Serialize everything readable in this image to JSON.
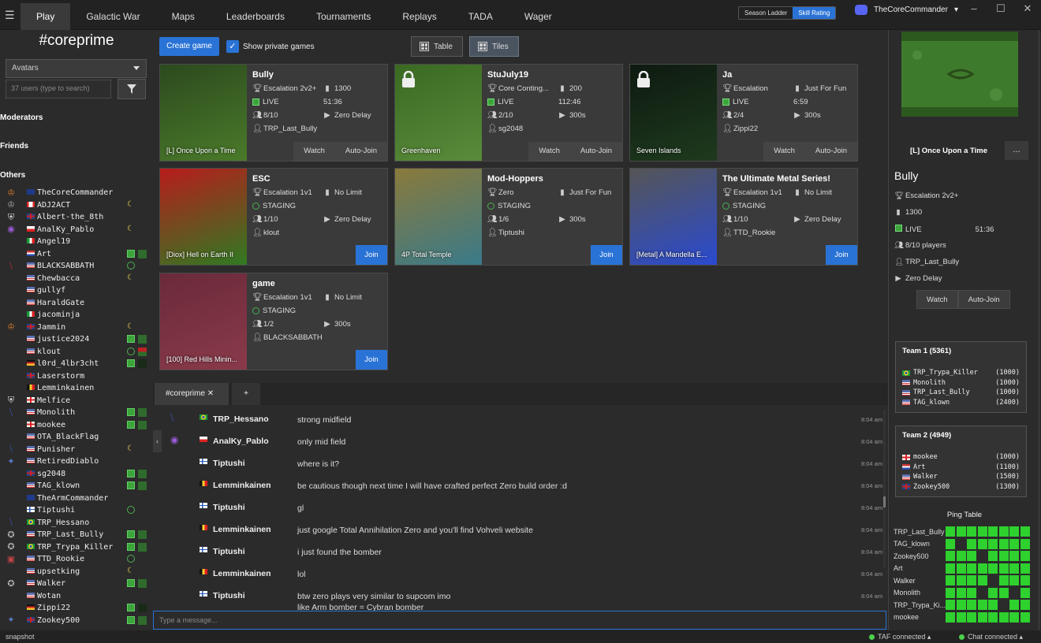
{
  "topbar": {
    "menu_icon": "hamburger-icon",
    "tabs": [
      "Play",
      "Galactic War",
      "Maps",
      "Leaderboards",
      "Tournaments",
      "Replays",
      "TADA",
      "Wager"
    ],
    "active_tab": "Play",
    "rating_toggle": [
      "Season Ladder",
      "Skill Rating"
    ],
    "rating_selected": "Skill Rating",
    "username": "TheCoreCommander",
    "window_controls": [
      "–",
      "☐",
      "✕"
    ]
  },
  "left": {
    "channel_title": "#coreprime",
    "avatar_select": "Avatars",
    "user_search_placeholder": "37 users (type to search)",
    "groups": [
      "Moderators",
      "Friends",
      "Others"
    ],
    "users": [
      {
        "name": "TheCoreCommander",
        "flag": "au",
        "avatar": "♔",
        "avcolor": "#e07a2a",
        "status": "",
        "map": ""
      },
      {
        "name": "ADJ2ACT",
        "flag": "ca",
        "avatar": "♔",
        "avcolor": "#aaa",
        "status": "moon",
        "map": ""
      },
      {
        "name": "Albert-the_8th",
        "flag": "gb",
        "avatar": "⛨",
        "avcolor": "#ddd",
        "status": "",
        "map": ""
      },
      {
        "name": "AnalKy_Pablo",
        "flag": "pl",
        "avatar": "◉",
        "avcolor": "#9a5ad6",
        "status": "moon",
        "map": ""
      },
      {
        "name": "Angel19",
        "flag": "it",
        "avatar": "",
        "avcolor": "",
        "status": "",
        "map": ""
      },
      {
        "name": "Art",
        "flag": "nl",
        "avatar": "",
        "avcolor": "",
        "status": "game",
        "map": "green"
      },
      {
        "name": "BLACKSABBATH",
        "flag": "us",
        "avatar": "⧹",
        "avcolor": "#c33",
        "status": "stg",
        "map": ""
      },
      {
        "name": "Chewbacca",
        "flag": "us",
        "avatar": "",
        "avcolor": "",
        "status": "moon",
        "map": ""
      },
      {
        "name": "gullyf",
        "flag": "us",
        "avatar": "",
        "avcolor": "",
        "status": "",
        "map": ""
      },
      {
        "name": "HaraldGate",
        "flag": "us",
        "avatar": "",
        "avcolor": "",
        "status": "",
        "map": ""
      },
      {
        "name": "jacominja",
        "flag": "it",
        "avatar": "",
        "avcolor": "",
        "status": "",
        "map": ""
      },
      {
        "name": "Jammin",
        "flag": "gb",
        "avatar": "♔",
        "avcolor": "#e07a2a",
        "status": "moon",
        "map": ""
      },
      {
        "name": "justice2024",
        "flag": "us",
        "avatar": "",
        "avcolor": "",
        "status": "game",
        "map": "green"
      },
      {
        "name": "klout",
        "flag": "us",
        "avatar": "",
        "avcolor": "",
        "status": "stg",
        "map": "red"
      },
      {
        "name": "l0rd_4lbr3cht",
        "flag": "de",
        "avatar": "",
        "avcolor": "",
        "status": "game",
        "map": "dark"
      },
      {
        "name": "Laserstorm",
        "flag": "gb",
        "avatar": "",
        "avcolor": "",
        "status": "",
        "map": ""
      },
      {
        "name": "Lemminkainen",
        "flag": "be",
        "avatar": "",
        "avcolor": "",
        "status": "",
        "map": ""
      },
      {
        "name": "Melfice",
        "flag": "ge",
        "avatar": "⛨",
        "avcolor": "#ddd",
        "status": "",
        "map": ""
      },
      {
        "name": "Monolith",
        "flag": "us",
        "avatar": "⧹",
        "avcolor": "#3a5acc",
        "status": "game",
        "map": "green"
      },
      {
        "name": "mookee",
        "flag": "ge",
        "avatar": "",
        "avcolor": "",
        "status": "game",
        "map": "green"
      },
      {
        "name": "OTA_BlackFlag",
        "flag": "us",
        "avatar": "",
        "avcolor": "",
        "status": "",
        "map": ""
      },
      {
        "name": "Punisher",
        "flag": "us",
        "avatar": "⧹",
        "avcolor": "#3a5acc",
        "status": "moon",
        "map": ""
      },
      {
        "name": "RetiredDiablo",
        "flag": "us",
        "avatar": "✦",
        "avcolor": "#5a7acc",
        "status": "",
        "map": ""
      },
      {
        "name": "sg2048",
        "flag": "gb",
        "avatar": "",
        "avcolor": "",
        "status": "game",
        "map": "green"
      },
      {
        "name": "TAG_klown",
        "flag": "us",
        "avatar": "",
        "avcolor": "",
        "status": "game",
        "map": "green"
      },
      {
        "name": "TheArmCommander",
        "flag": "au",
        "avatar": "",
        "avcolor": "",
        "status": "",
        "map": ""
      },
      {
        "name": "Tiptushi",
        "flag": "fi",
        "avatar": "",
        "avcolor": "",
        "status": "stg",
        "map": ""
      },
      {
        "name": "TRP_Hessano",
        "flag": "br",
        "avatar": "⧹",
        "avcolor": "#3a5acc",
        "status": "",
        "map": ""
      },
      {
        "name": "TRP_Last_Bully",
        "flag": "us",
        "avatar": "✪",
        "avcolor": "#aaa",
        "status": "game",
        "map": "green"
      },
      {
        "name": "TRP_Trypa_Killer",
        "flag": "br",
        "avatar": "✪",
        "avcolor": "#aaa",
        "status": "game",
        "map": "green"
      },
      {
        "name": "TTD_Rookie",
        "flag": "us",
        "avatar": "▣",
        "avcolor": "#b44",
        "status": "stg",
        "map": ""
      },
      {
        "name": "upsetking",
        "flag": "us",
        "avatar": "",
        "avcolor": "",
        "status": "moon",
        "map": ""
      },
      {
        "name": "Walker",
        "flag": "us",
        "avatar": "✪",
        "avcolor": "#aaa",
        "status": "game",
        "map": "green"
      },
      {
        "name": "Wotan",
        "flag": "us",
        "avatar": "",
        "avcolor": "",
        "status": "",
        "map": ""
      },
      {
        "name": "Zippi22",
        "flag": "de",
        "avatar": "",
        "avcolor": "",
        "status": "game",
        "map": "dark"
      },
      {
        "name": "Zookey500",
        "flag": "gb",
        "avatar": "✦",
        "avcolor": "#5a7acc",
        "status": "game",
        "map": "green"
      }
    ]
  },
  "games_toolbar": {
    "create_label": "Create game",
    "show_private_label": "Show private games",
    "show_private_checked": true,
    "view_table": "Table",
    "view_tiles": "Tiles",
    "view_selected": "Tiles"
  },
  "games": [
    {
      "title": "Bully",
      "map_name": "[L] Once Upon a Time",
      "locked": false,
      "state": "live",
      "mod": "Escalation 2v2+",
      "rating": "1300",
      "status": "LIVE",
      "time_or_level": "51:36",
      "players": "8/10",
      "delay": "Zero Delay",
      "host": "TRP_Last_Bully",
      "actions": [
        "Watch",
        "Auto-Join"
      ],
      "map_colors": [
        "#2c4a1e",
        "#4a7a2a"
      ]
    },
    {
      "title": "StuJuly19",
      "map_name": "Greenhaven",
      "locked": true,
      "state": "live",
      "mod": "Core Conting...",
      "rating": "200",
      "status": "LIVE",
      "time_or_level": "112:46",
      "players": "2/10",
      "delay": "300s",
      "host": "sg2048",
      "actions": [
        "Watch",
        "Auto-Join"
      ],
      "map_colors": [
        "#3a6a22",
        "#5a8a3a"
      ]
    },
    {
      "title": "Ja",
      "map_name": "Seven Islands",
      "locked": true,
      "state": "live",
      "mod": "Escalation",
      "rating": "Just For Fun",
      "status": "LIVE",
      "time_or_level": "6:59",
      "players": "2/4",
      "delay": "300s",
      "host": "Zippi22",
      "actions": [
        "Watch",
        "Auto-Join"
      ],
      "map_colors": [
        "#0e1a10",
        "#1e3a1e"
      ]
    },
    {
      "title": "ESC",
      "map_name": "[Diox] Hell on Earth II",
      "locked": false,
      "state": "staging",
      "mod": "Escalation 1v1",
      "rating": "No Limit",
      "status": "STAGING",
      "time_or_level": "",
      "players": "1/10",
      "delay": "Zero Delay",
      "host": "klout",
      "actions": [
        "Join"
      ],
      "map_colors": [
        "#b81c1c",
        "#2f7a22"
      ]
    },
    {
      "title": "Mod-Hoppers",
      "map_name": "4P Total Temple",
      "locked": false,
      "state": "staging",
      "mod": "Zero",
      "rating": "Just For Fun",
      "status": "STAGING",
      "time_or_level": "",
      "players": "1/6",
      "delay": "300s",
      "host": "Tiptushi",
      "actions": [
        "Join"
      ],
      "map_colors": [
        "#8a7a3a",
        "#3a7a8a"
      ]
    },
    {
      "title": "The Ultimate Metal Series!",
      "map_name": "[Metal] A Mandella E...",
      "locked": false,
      "state": "staging",
      "mod": "Escalation 1v1",
      "rating": "No Limit",
      "status": "STAGING",
      "time_or_level": "",
      "players": "1/10",
      "delay": "Zero Delay",
      "host": "TTD_Rookie",
      "actions": [
        "Join"
      ],
      "map_colors": [
        "#555555",
        "#2a4ad0"
      ]
    },
    {
      "title": "game",
      "map_name": "[100] Red Hills Minin...",
      "locked": false,
      "state": "staging",
      "mod": "Escalation 1v1",
      "rating": "No Limit",
      "status": "STAGING",
      "time_or_level": "",
      "players": "1/2",
      "delay": "300s",
      "host": "BLACKSABBATH",
      "actions": [
        "Join"
      ],
      "map_colors": [
        "#6a2a3a",
        "#8a3a4a"
      ]
    }
  ],
  "chat": {
    "tabs": [
      "#coreprime ✕",
      "+"
    ],
    "input_placeholder": "Type a message...",
    "messages": [
      {
        "user": "TRP_Hessano",
        "flag": "br",
        "avatar": "⧹",
        "avcolor": "#3a5acc",
        "text": "strong midfield",
        "time": "8:04 am"
      },
      {
        "user": "AnalKy_Pablo",
        "flag": "pl",
        "avatar": "◉",
        "avcolor": "#9a5ad6",
        "text": "only mid field",
        "time": "8:04 am"
      },
      {
        "user": "Tiptushi",
        "flag": "fi",
        "avatar": "",
        "avcolor": "",
        "text": "where is it?",
        "time": "8:04 am"
      },
      {
        "user": "Lemminkainen",
        "flag": "be",
        "avatar": "",
        "avcolor": "",
        "text": "be cautious though next time I will have crafted perfect Zero build order :d",
        "time": "8:04 am"
      },
      {
        "user": "Tiptushi",
        "flag": "fi",
        "avatar": "",
        "avcolor": "",
        "text": "gl",
        "time": "8:04 am"
      },
      {
        "user": "Lemminkainen",
        "flag": "be",
        "avatar": "",
        "avcolor": "",
        "text": "just google Total Annihilation Zero and you'll find Vohveli website",
        "time": "8:04 am"
      },
      {
        "user": "Tiptushi",
        "flag": "fi",
        "avatar": "",
        "avcolor": "",
        "text": "i just found the bomber",
        "time": "8:04 am"
      },
      {
        "user": "Lemminkainen",
        "flag": "be",
        "avatar": "",
        "avcolor": "",
        "text": "lol",
        "time": "8:04 am"
      },
      {
        "user": "Tiptushi",
        "flag": "fi",
        "avatar": "",
        "avcolor": "",
        "text": "btw zero plays very similar to supcom imo",
        "text2": "like Arm bomber = Cybran bomber",
        "time": "8:04 am"
      }
    ]
  },
  "right": {
    "map_name": "[L] Once Upon a Time",
    "more_label": "...",
    "title": "Bully",
    "mod": "Escalation 2v2+",
    "rating": "1300",
    "status": "LIVE",
    "time": "51:36",
    "players": "8/10 players",
    "host": "TRP_Last_Bully",
    "delay": "Zero Delay",
    "actions": [
      "Watch",
      "Auto-Join"
    ],
    "teams": [
      {
        "name": "Team 1 (5361)",
        "members": [
          {
            "flag": "br",
            "name": "TRP_Trypa_Killer",
            "rating": "(1000)"
          },
          {
            "flag": "us",
            "name": "Monolith",
            "rating": "(1000)"
          },
          {
            "flag": "us",
            "name": "TRP_Last_Bully",
            "rating": "(1000)"
          },
          {
            "flag": "us",
            "name": "TAG_klown",
            "rating": "(2400)"
          }
        ]
      },
      {
        "name": "Team 2 (4949)",
        "members": [
          {
            "flag": "ge",
            "name": "mookee",
            "rating": "(1000)"
          },
          {
            "flag": "nl",
            "name": "Art",
            "rating": "(1100)"
          },
          {
            "flag": "us",
            "name": "Walker",
            "rating": "(1500)"
          },
          {
            "flag": "gb",
            "name": "Zookey500",
            "rating": "(1300)"
          }
        ]
      }
    ],
    "ping_title": "Ping Table",
    "ping_rows": [
      {
        "name": "TRP_Last_Bully",
        "cells": [
          1,
          1,
          1,
          1,
          1,
          1,
          1,
          1
        ]
      },
      {
        "name": "TAG_klown",
        "cells": [
          1,
          0,
          1,
          1,
          1,
          1,
          1,
          1
        ]
      },
      {
        "name": "Zookey500",
        "cells": [
          1,
          1,
          1,
          0,
          1,
          1,
          1,
          1
        ]
      },
      {
        "name": "Art",
        "cells": [
          1,
          1,
          1,
          1,
          1,
          1,
          1,
          1
        ]
      },
      {
        "name": "Walker",
        "cells": [
          1,
          1,
          1,
          1,
          0,
          1,
          1,
          1
        ]
      },
      {
        "name": "Monolith",
        "cells": [
          1,
          1,
          1,
          0,
          1,
          1,
          0,
          1
        ]
      },
      {
        "name": "TRP_Trypa_Ki...",
        "cells": [
          1,
          1,
          1,
          1,
          1,
          0,
          1,
          1
        ]
      },
      {
        "name": "mookee",
        "cells": [
          1,
          1,
          1,
          1,
          1,
          1,
          1,
          1
        ]
      }
    ]
  },
  "statusbar": {
    "left": "snapshot",
    "taf": "TAF connected ▴",
    "chat": "Chat connected ▴"
  }
}
